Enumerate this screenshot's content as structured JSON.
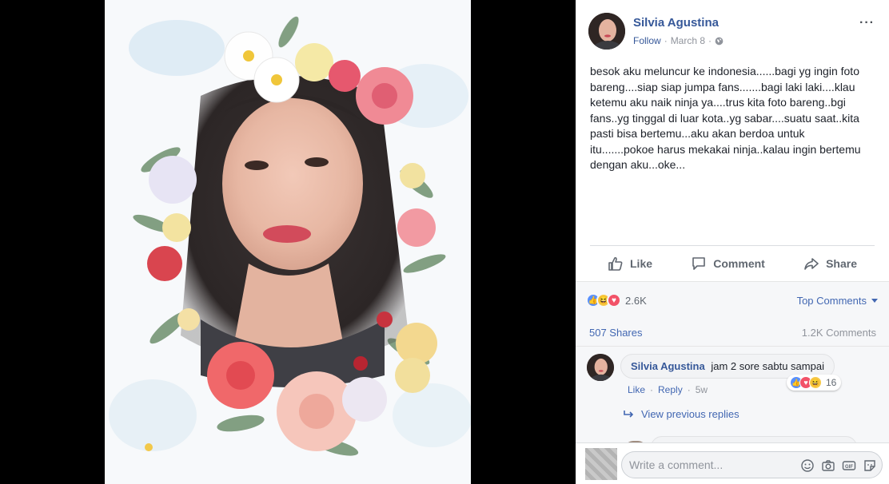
{
  "post": {
    "author": "Silvia Agustina",
    "follow": "Follow",
    "dot": "·",
    "date": "March 8",
    "more": "···",
    "text": "besok aku meluncur ke indonesia......bagi yg ingin foto bareng....siap siap jumpa fans.......bagi laki laki....klau ketemu aku naik ninja ya....trus kita foto bareng..bgi fans..yg tinggal di luar kota..yg sabar....suatu saat..kita pasti bisa bertemu...aku akan berdoa untuk itu.......pokoe harus mekakai ninja..kalau ingin bertemu dengan aku...oke..."
  },
  "actions": {
    "like": "Like",
    "comment": "Comment",
    "share": "Share"
  },
  "stats": {
    "reaction_count": "2.6K",
    "top_comments": "Top Comments",
    "shares": "507 Shares",
    "comments": "1.2K Comments"
  },
  "comment": {
    "author": "Silvia Agustina",
    "text": "jam 2 sore sabtu sampai",
    "like": "Like",
    "dot": "·",
    "reply": "Reply",
    "time": "5w",
    "reaction_count": "16"
  },
  "view_replies": "View previous replies",
  "composer": {
    "placeholder": "Write a comment..."
  },
  "colors": {
    "link": "#365899",
    "accent": "#4267b2"
  }
}
